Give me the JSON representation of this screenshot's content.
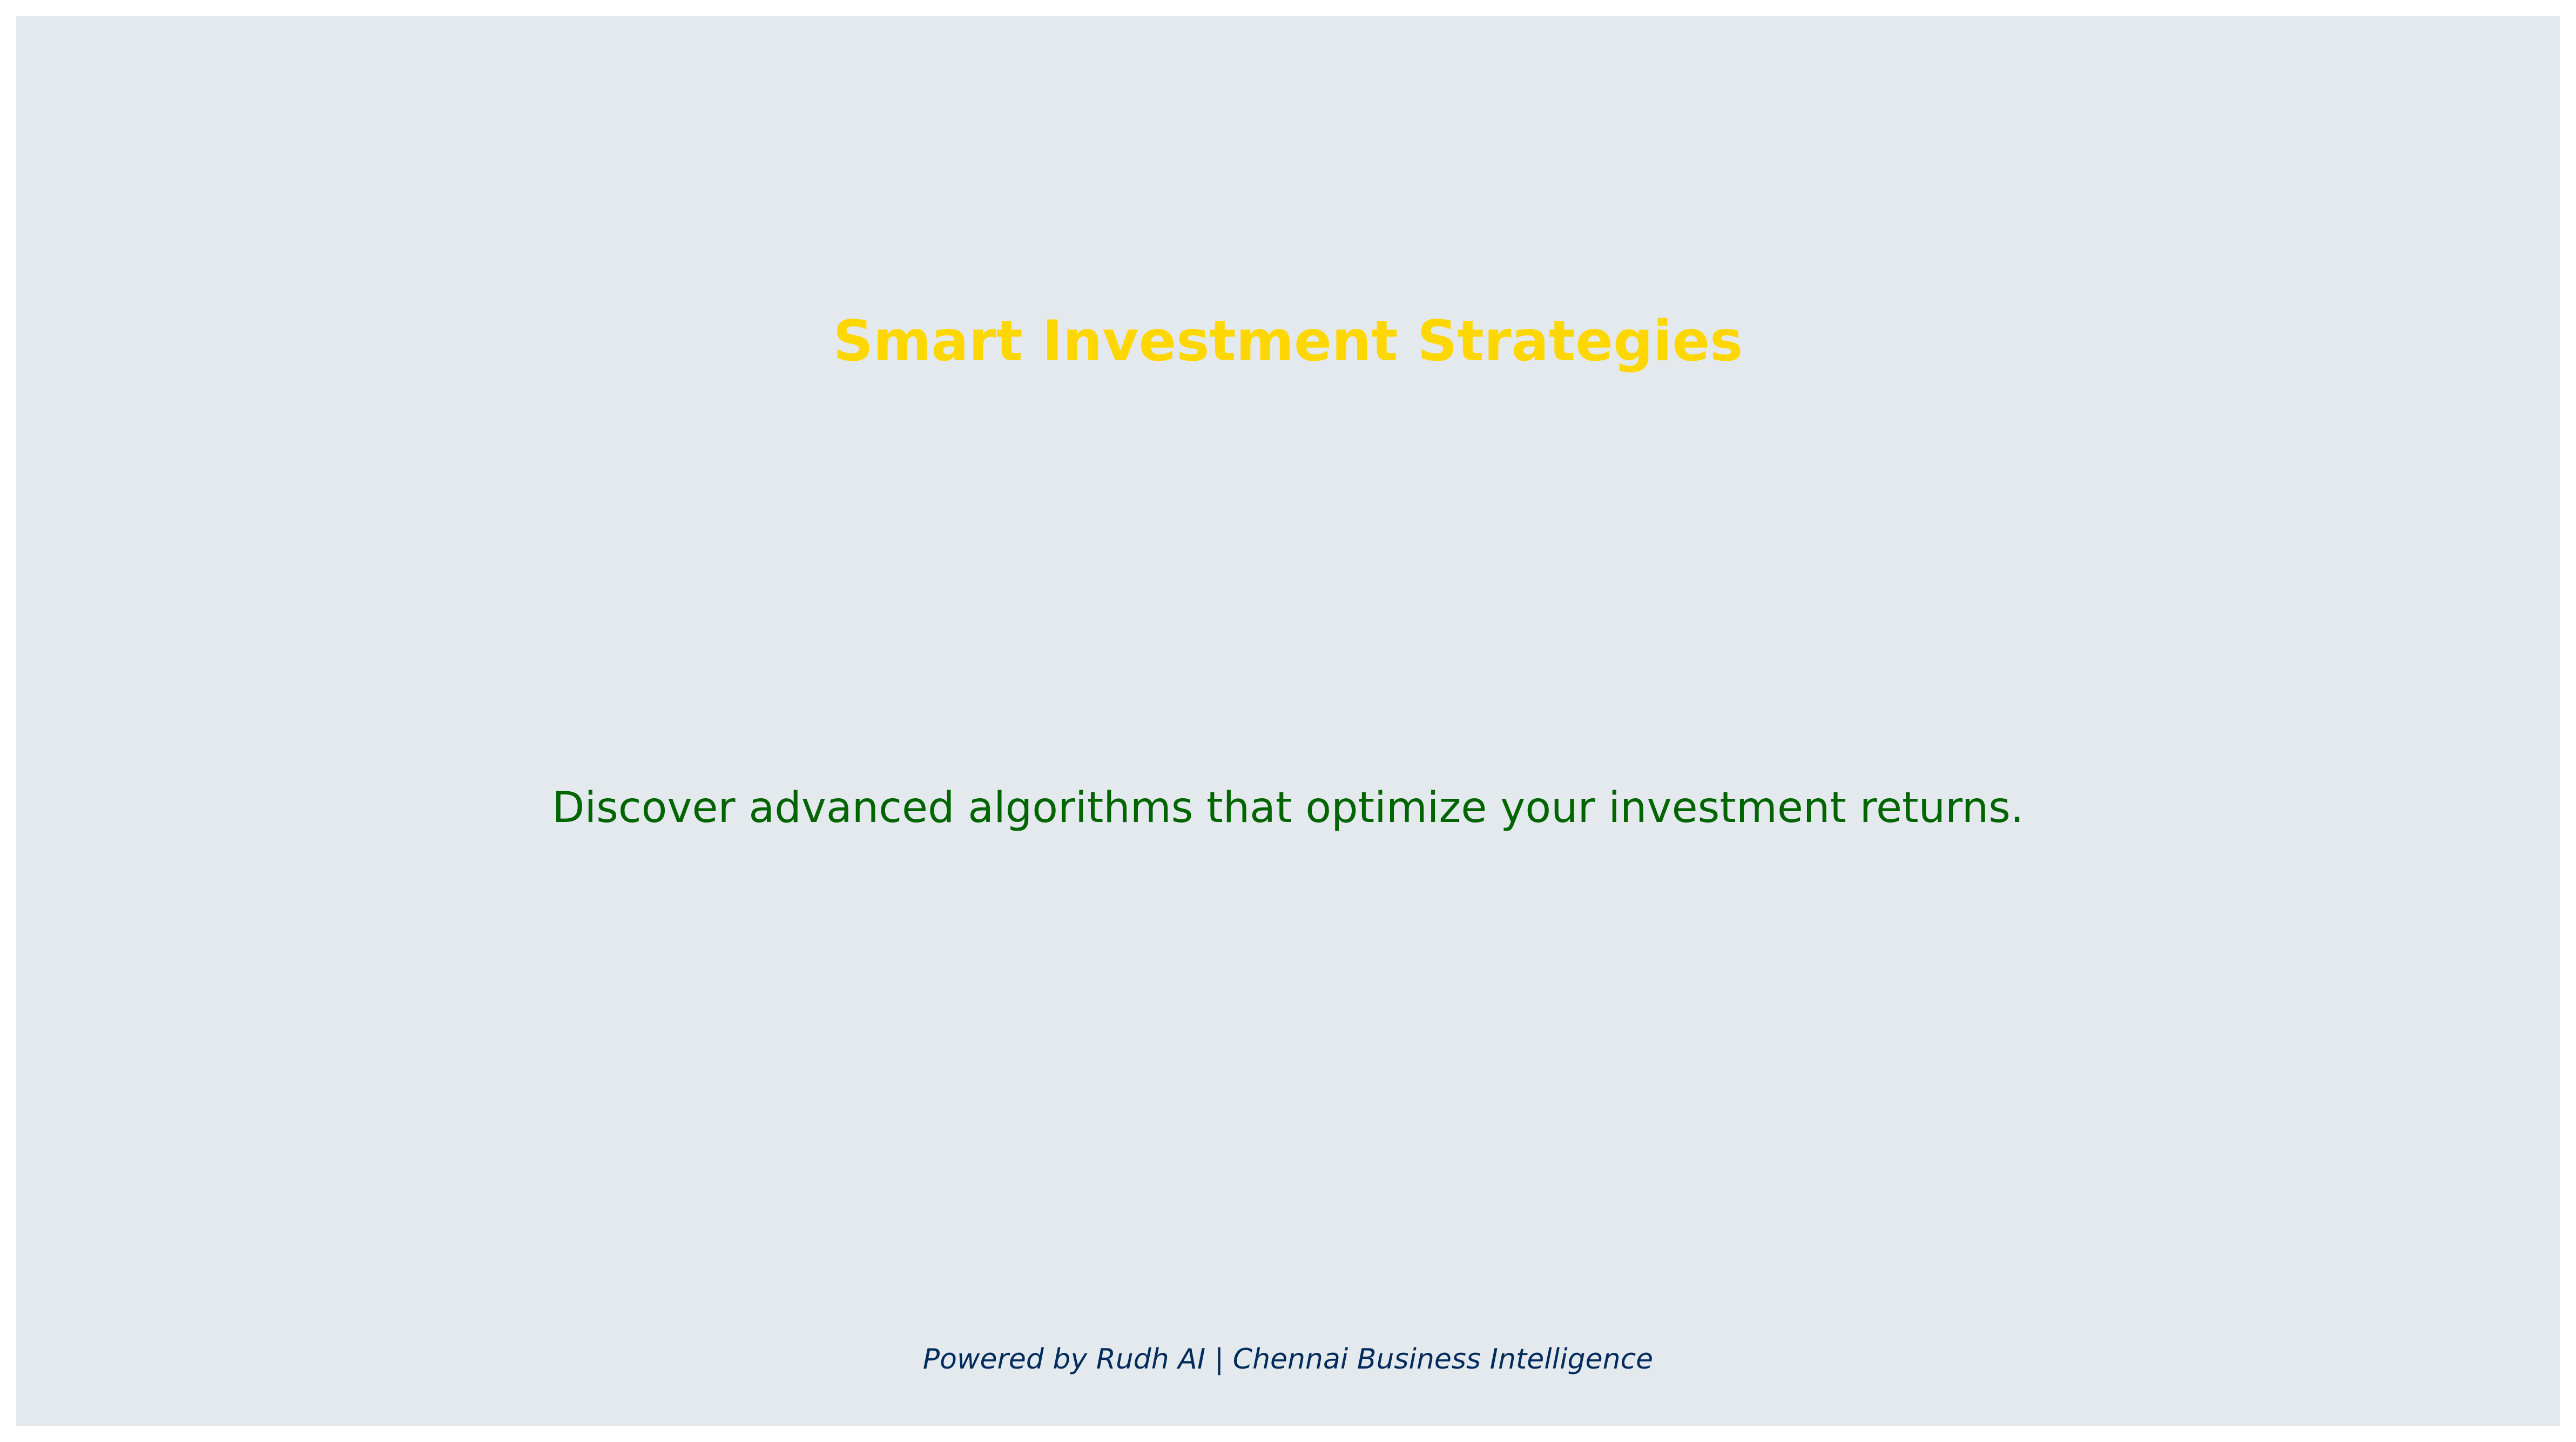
{
  "slide": {
    "background_color": "#e4e9ee",
    "title": "Smart Investment Strategies",
    "title_color": "#ffd700",
    "subtitle": "Discover advanced algorithms that optimize your investment returns.",
    "subtitle_color": "#006400",
    "footer": "Powered by Rudh AI | Chennai Business Intelligence",
    "footer_color": "#002b5c"
  }
}
